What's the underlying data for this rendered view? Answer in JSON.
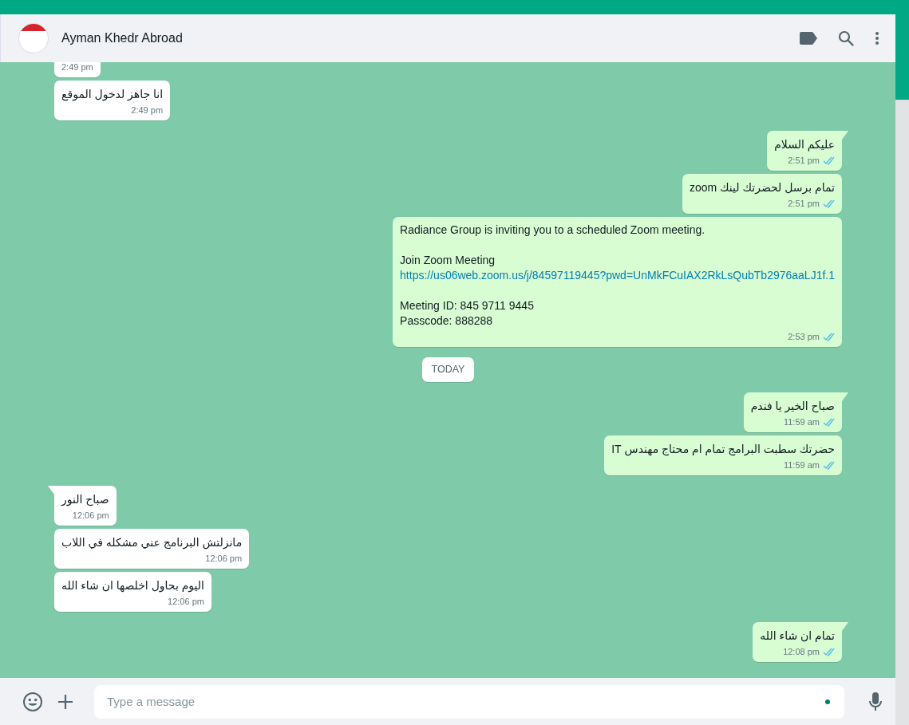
{
  "header": {
    "contact_name": "Ayman Khedr Abroad"
  },
  "messages": [
    {
      "kind": "incoming",
      "tail": false,
      "time": "2:49 pm"
    },
    {
      "kind": "incoming",
      "tail": false,
      "text": "انا جاهز لدخول الموقع",
      "time": "2:49 pm"
    },
    {
      "kind": "outgoing",
      "tail": true,
      "text": "عليكم السلام",
      "time": "2:51 pm",
      "read": true
    },
    {
      "kind": "outgoing",
      "tail": false,
      "text": "تمام برسل لحضرتك لينك zoom",
      "time": "2:51 pm",
      "read": true
    },
    {
      "kind": "outgoing",
      "tail": false,
      "blocks": [
        [
          {
            "text": "Radiance Group is inviting you to a scheduled Zoom meeting.",
            "link": false
          }
        ],
        [
          {
            "text": "Join Zoom Meeting",
            "link": false
          },
          {
            "text": "https://us06web.zoom.us/j/84597119445?pwd=UnMkFCuIAX2RkLsQubTb2976aaLJ1f.1",
            "link": true
          }
        ],
        [
          {
            "text": "Meeting ID: 845 9711 9445",
            "link": false
          },
          {
            "text": "Passcode: 888288",
            "link": false
          }
        ]
      ],
      "time": "2:53 pm",
      "read": true
    },
    {
      "kind": "date",
      "text": "TODAY"
    },
    {
      "kind": "outgoing",
      "tail": true,
      "text": "صباح الخير يا فندم",
      "time": "11:59 am",
      "read": true
    },
    {
      "kind": "outgoing",
      "tail": false,
      "text": "حضرتك سطبت البرامج تمام ام محتاج مهندس IT",
      "time": "11:59 am",
      "read": true
    },
    {
      "kind": "incoming",
      "tail": true,
      "text": "صباح النور",
      "time": "12:06 pm"
    },
    {
      "kind": "incoming",
      "tail": false,
      "text": "مانزلتش البرنامج عني مشكله في اللاب",
      "time": "12:06 pm"
    },
    {
      "kind": "incoming",
      "tail": false,
      "text": "اليوم بحاول اخلصها ان شاء الله",
      "time": "12:06 pm"
    },
    {
      "kind": "outgoing",
      "tail": true,
      "text": "تمام ان شاء الله",
      "time": "12:08 pm",
      "read": true
    }
  ],
  "composer": {
    "placeholder": "Type a message"
  }
}
